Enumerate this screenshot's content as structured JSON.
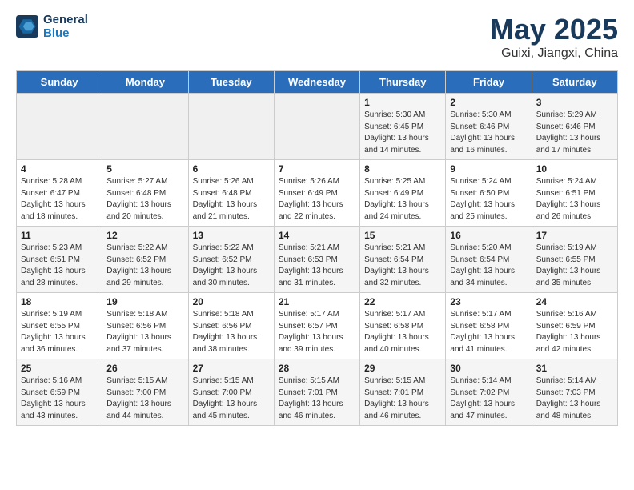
{
  "logo": {
    "line1": "General",
    "line2": "Blue"
  },
  "title": "May 2025",
  "subtitle": "Guixi, Jiangxi, China",
  "weekdays": [
    "Sunday",
    "Monday",
    "Tuesday",
    "Wednesday",
    "Thursday",
    "Friday",
    "Saturday"
  ],
  "weeks": [
    [
      {
        "day": "",
        "empty": true
      },
      {
        "day": "",
        "empty": true
      },
      {
        "day": "",
        "empty": true
      },
      {
        "day": "",
        "empty": true
      },
      {
        "day": "1",
        "details": "Sunrise: 5:30 AM\nSunset: 6:45 PM\nDaylight: 13 hours\nand 14 minutes."
      },
      {
        "day": "2",
        "details": "Sunrise: 5:30 AM\nSunset: 6:46 PM\nDaylight: 13 hours\nand 16 minutes."
      },
      {
        "day": "3",
        "details": "Sunrise: 5:29 AM\nSunset: 6:46 PM\nDaylight: 13 hours\nand 17 minutes."
      }
    ],
    [
      {
        "day": "4",
        "details": "Sunrise: 5:28 AM\nSunset: 6:47 PM\nDaylight: 13 hours\nand 18 minutes."
      },
      {
        "day": "5",
        "details": "Sunrise: 5:27 AM\nSunset: 6:48 PM\nDaylight: 13 hours\nand 20 minutes."
      },
      {
        "day": "6",
        "details": "Sunrise: 5:26 AM\nSunset: 6:48 PM\nDaylight: 13 hours\nand 21 minutes."
      },
      {
        "day": "7",
        "details": "Sunrise: 5:26 AM\nSunset: 6:49 PM\nDaylight: 13 hours\nand 22 minutes."
      },
      {
        "day": "8",
        "details": "Sunrise: 5:25 AM\nSunset: 6:49 PM\nDaylight: 13 hours\nand 24 minutes."
      },
      {
        "day": "9",
        "details": "Sunrise: 5:24 AM\nSunset: 6:50 PM\nDaylight: 13 hours\nand 25 minutes."
      },
      {
        "day": "10",
        "details": "Sunrise: 5:24 AM\nSunset: 6:51 PM\nDaylight: 13 hours\nand 26 minutes."
      }
    ],
    [
      {
        "day": "11",
        "details": "Sunrise: 5:23 AM\nSunset: 6:51 PM\nDaylight: 13 hours\nand 28 minutes."
      },
      {
        "day": "12",
        "details": "Sunrise: 5:22 AM\nSunset: 6:52 PM\nDaylight: 13 hours\nand 29 minutes."
      },
      {
        "day": "13",
        "details": "Sunrise: 5:22 AM\nSunset: 6:52 PM\nDaylight: 13 hours\nand 30 minutes."
      },
      {
        "day": "14",
        "details": "Sunrise: 5:21 AM\nSunset: 6:53 PM\nDaylight: 13 hours\nand 31 minutes."
      },
      {
        "day": "15",
        "details": "Sunrise: 5:21 AM\nSunset: 6:54 PM\nDaylight: 13 hours\nand 32 minutes."
      },
      {
        "day": "16",
        "details": "Sunrise: 5:20 AM\nSunset: 6:54 PM\nDaylight: 13 hours\nand 34 minutes."
      },
      {
        "day": "17",
        "details": "Sunrise: 5:19 AM\nSunset: 6:55 PM\nDaylight: 13 hours\nand 35 minutes."
      }
    ],
    [
      {
        "day": "18",
        "details": "Sunrise: 5:19 AM\nSunset: 6:55 PM\nDaylight: 13 hours\nand 36 minutes."
      },
      {
        "day": "19",
        "details": "Sunrise: 5:18 AM\nSunset: 6:56 PM\nDaylight: 13 hours\nand 37 minutes."
      },
      {
        "day": "20",
        "details": "Sunrise: 5:18 AM\nSunset: 6:56 PM\nDaylight: 13 hours\nand 38 minutes."
      },
      {
        "day": "21",
        "details": "Sunrise: 5:17 AM\nSunset: 6:57 PM\nDaylight: 13 hours\nand 39 minutes."
      },
      {
        "day": "22",
        "details": "Sunrise: 5:17 AM\nSunset: 6:58 PM\nDaylight: 13 hours\nand 40 minutes."
      },
      {
        "day": "23",
        "details": "Sunrise: 5:17 AM\nSunset: 6:58 PM\nDaylight: 13 hours\nand 41 minutes."
      },
      {
        "day": "24",
        "details": "Sunrise: 5:16 AM\nSunset: 6:59 PM\nDaylight: 13 hours\nand 42 minutes."
      }
    ],
    [
      {
        "day": "25",
        "details": "Sunrise: 5:16 AM\nSunset: 6:59 PM\nDaylight: 13 hours\nand 43 minutes."
      },
      {
        "day": "26",
        "details": "Sunrise: 5:15 AM\nSunset: 7:00 PM\nDaylight: 13 hours\nand 44 minutes."
      },
      {
        "day": "27",
        "details": "Sunrise: 5:15 AM\nSunset: 7:00 PM\nDaylight: 13 hours\nand 45 minutes."
      },
      {
        "day": "28",
        "details": "Sunrise: 5:15 AM\nSunset: 7:01 PM\nDaylight: 13 hours\nand 46 minutes."
      },
      {
        "day": "29",
        "details": "Sunrise: 5:15 AM\nSunset: 7:01 PM\nDaylight: 13 hours\nand 46 minutes."
      },
      {
        "day": "30",
        "details": "Sunrise: 5:14 AM\nSunset: 7:02 PM\nDaylight: 13 hours\nand 47 minutes."
      },
      {
        "day": "31",
        "details": "Sunrise: 5:14 AM\nSunset: 7:03 PM\nDaylight: 13 hours\nand 48 minutes."
      }
    ]
  ]
}
